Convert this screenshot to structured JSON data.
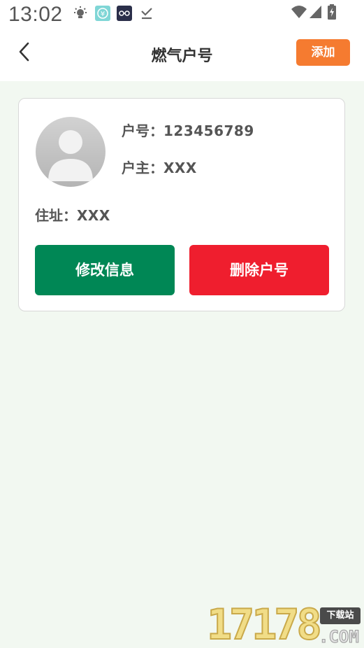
{
  "status_bar": {
    "time": "13:02",
    "icons": [
      "lightbulb-icon",
      "yuan-app-icon",
      "glasses-app-icon",
      "download-done-icon",
      "wifi-icon",
      "signal-icon",
      "battery-charging-icon"
    ]
  },
  "header": {
    "title": "燃气户号",
    "back_icon": "chevron-left-icon",
    "add_label": "添加"
  },
  "account": {
    "number_label": "户号：",
    "number_value": "123456789",
    "owner_label": "户主：",
    "owner_value": "XXX",
    "address_label": "住址：",
    "address_value": "XXX",
    "edit_label": "修改信息",
    "delete_label": "删除户号"
  },
  "watermark": {
    "digits": "17178",
    "tag": "下载站",
    "domain": ".COM"
  },
  "colors": {
    "add_button": "#f57b30",
    "edit_button": "#008755",
    "delete_button": "#ef1e2e",
    "page_background": "#f2f8f1"
  }
}
